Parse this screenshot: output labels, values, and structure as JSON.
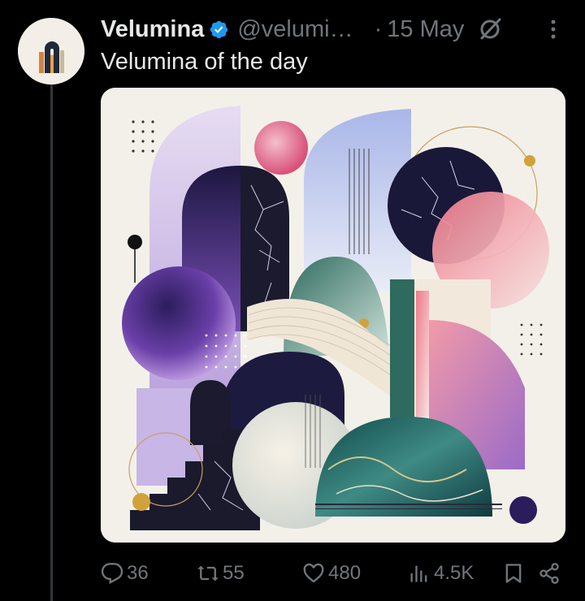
{
  "post": {
    "author_name": "Velumina",
    "handle": "@velumi…",
    "date_separator": "·",
    "date": "15 May",
    "text": "Velumina of the day",
    "verified_color": "#1d9bf0",
    "icons": {
      "verified": "verified-badge-icon",
      "grok": "grok-icon",
      "more": "more-options-icon",
      "avatar": "velumina-logo"
    }
  },
  "actions": {
    "replies": "36",
    "reposts": "55",
    "likes": "480",
    "views": "4.5K",
    "icons": [
      "reply-icon",
      "repost-icon",
      "like-icon",
      "views-icon",
      "bookmark-icon",
      "share-icon"
    ]
  },
  "media": {
    "description": "abstract geometric artwork",
    "colors": [
      "#f3f0ea",
      "#2a1f5c",
      "#b79be0",
      "#c8d2f0",
      "#2e6a5e",
      "#f2a6a6",
      "#d2a23a",
      "#1b1a2e"
    ]
  }
}
